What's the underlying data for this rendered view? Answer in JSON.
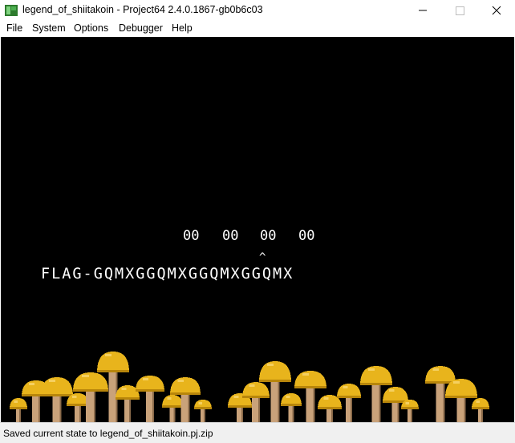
{
  "window": {
    "title": "legend_of_shiitakoin - Project64 2.4.0.1867-gb0b6c03",
    "icon": "project64-icon",
    "controls": [
      "minimize-icon",
      "maximize-icon",
      "close-icon"
    ]
  },
  "menu": {
    "items": [
      {
        "label": "File"
      },
      {
        "label": "System"
      },
      {
        "label": "Options"
      },
      {
        "label": "Debugger"
      },
      {
        "label": "Help"
      }
    ]
  },
  "game": {
    "background_color": "#000000",
    "text_color": "#ffffff",
    "hex_values": [
      "00",
      "00",
      "00",
      "00"
    ],
    "cursor": "^",
    "flag_text": "FLAG-GQMXGGQMXGGQMXGGQMX",
    "mushroom_colors": {
      "cap": "#e8b41c",
      "cap_shadow": "#b8860b",
      "cap_highlight": "#f5d060",
      "stem": "#c9a27a",
      "stem_shadow": "#8a6a4a"
    }
  },
  "status": {
    "text": "Saved current state to legend_of_shiitakoin.pj.zip"
  }
}
